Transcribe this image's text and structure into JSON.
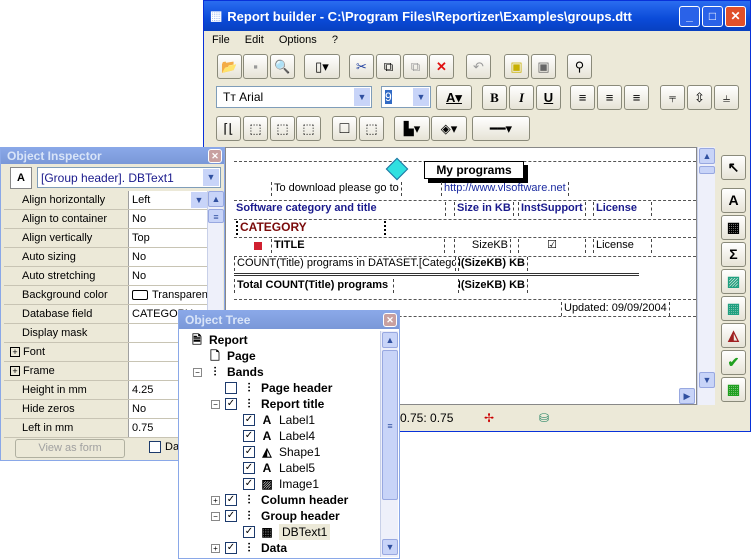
{
  "main": {
    "title": "Report builder - C:\\Program Files\\Reportizer\\Examples\\groups.dtt",
    "menu": [
      "File",
      "Edit",
      "Options",
      "?"
    ],
    "font_name": "Arial",
    "font_size": "9",
    "status": {
      "coords": "0.75:  0.75"
    }
  },
  "report": {
    "title_label": "My programs",
    "download_text": "To download please go to",
    "link": "http://www.vlsoftware.net",
    "headers": [
      "Software category and title",
      "Size in KB",
      "InstSupport",
      "License"
    ],
    "category": "CATEGORY",
    "title_field": "TITLE",
    "size_field": "SizeKB",
    "license_field": "License",
    "group_footer": "COUNT(Title) programs in DATASET.[Category]",
    "group_sum": "SUM(SizeKB) KB",
    "total": "Total COUNT(Title) programs",
    "total_sum": "SUM(SizeKB) KB",
    "updated": "Updated: 09/09/2004"
  },
  "inspector": {
    "title": "Object Inspector",
    "object": "[Group header].  DBText1",
    "rows": [
      {
        "k": "Align horizontally",
        "v": "Left"
      },
      {
        "k": "Align to container",
        "v": "No"
      },
      {
        "k": "Align vertically",
        "v": "Top"
      },
      {
        "k": "Auto sizing",
        "v": "No"
      },
      {
        "k": "Auto stretching",
        "v": "No"
      },
      {
        "k": "Background color",
        "v": "Transparent"
      },
      {
        "k": "Database field",
        "v": "CATEGORY"
      },
      {
        "k": "Display mask",
        "v": ""
      },
      {
        "k": "Font",
        "v": ""
      },
      {
        "k": "Frame",
        "v": ""
      },
      {
        "k": "Height in mm",
        "v": "4.25"
      },
      {
        "k": "Hide zeros",
        "v": "No"
      },
      {
        "k": "Left in mm",
        "v": "0.75"
      }
    ],
    "view_button": "View as form",
    "data_checkbox": "Data"
  },
  "tree": {
    "title": "Object Tree",
    "items": [
      {
        "label": "Report",
        "bold": true
      },
      {
        "label": "Page",
        "bold": true
      },
      {
        "label": "Bands",
        "bold": true
      },
      {
        "label": "Page header",
        "bold": true,
        "checked": false
      },
      {
        "label": "Report title",
        "bold": true,
        "checked": true
      },
      {
        "label": "Label1",
        "checked": true
      },
      {
        "label": "Label4",
        "checked": true
      },
      {
        "label": "Shape1",
        "checked": true
      },
      {
        "label": "Label5",
        "checked": true
      },
      {
        "label": "Image1",
        "checked": true
      },
      {
        "label": "Column header",
        "bold": true,
        "checked": true
      },
      {
        "label": "Group header",
        "bold": true,
        "checked": true
      },
      {
        "label": "DBText1",
        "checked": true,
        "selected": true
      },
      {
        "label": "Data",
        "bold": true,
        "checked": true
      }
    ]
  }
}
